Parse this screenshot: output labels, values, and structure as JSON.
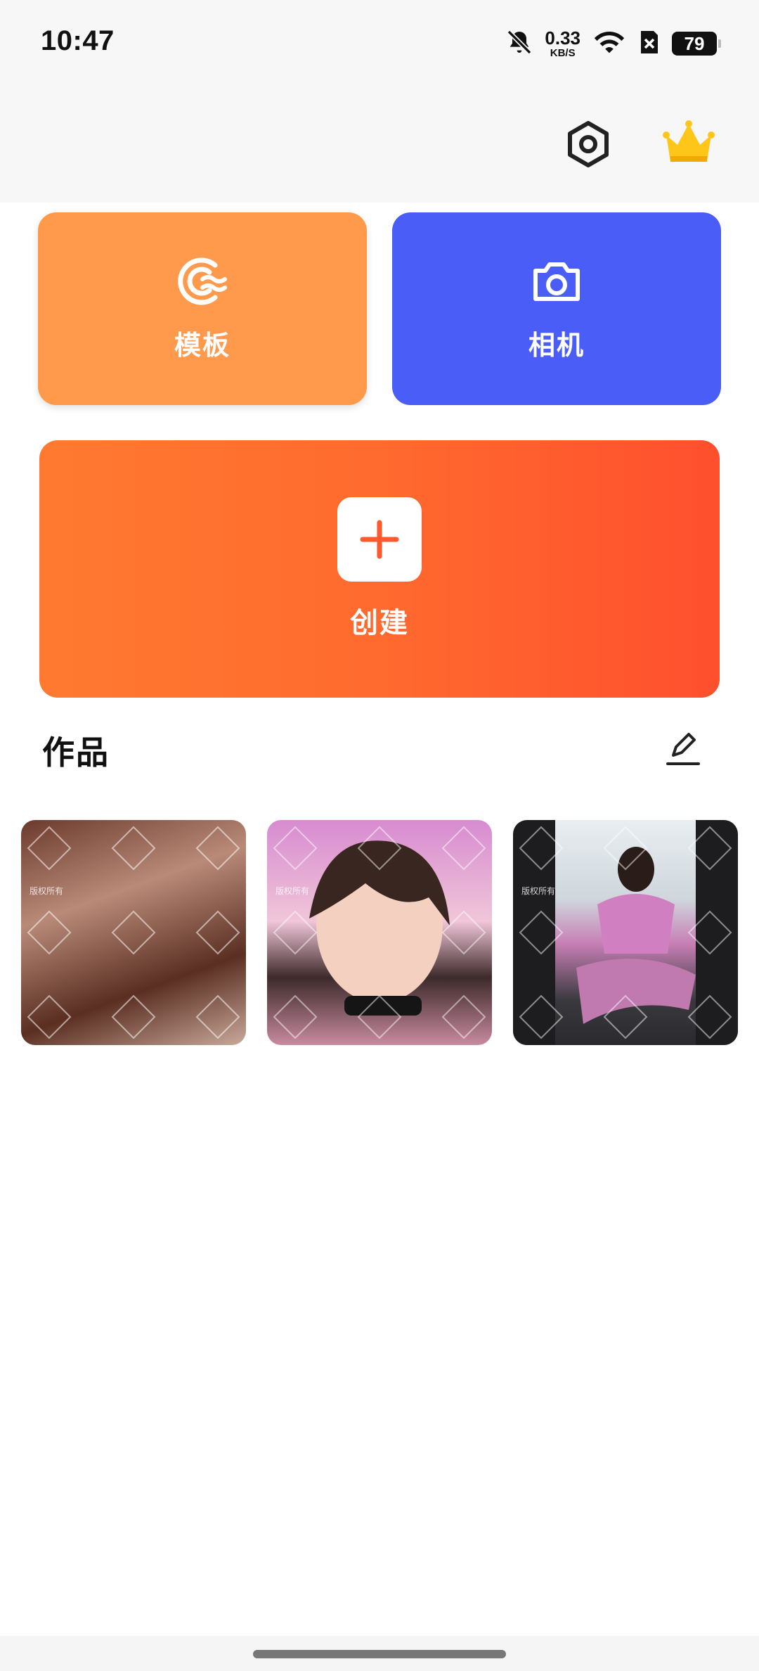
{
  "status_bar": {
    "time": "10:47",
    "net_speed_value": "0.33",
    "net_speed_unit": "KB/S",
    "battery": "79",
    "icons": [
      "bell-off-icon",
      "wifi-icon",
      "sim-off-icon",
      "battery-icon"
    ]
  },
  "header": {
    "icons": [
      "settings-hexagon-icon",
      "crown-icon"
    ],
    "crown_color": "#ffc61a"
  },
  "actions": {
    "template": {
      "label": "模板",
      "icon": "wave-logo-icon",
      "color": "#ff9a4c"
    },
    "camera": {
      "label": "相机",
      "icon": "camera-icon",
      "color": "#4a5ef7"
    },
    "create": {
      "label": "创建",
      "icon": "plus-icon",
      "color": "#ff6a2e"
    }
  },
  "works": {
    "title": "作品",
    "edit_icon": "edit-pencil-icon",
    "items": [
      {
        "name": "work-thumbnail-1",
        "watermark": "版权所有"
      },
      {
        "name": "work-thumbnail-2",
        "watermark": "版权所有"
      },
      {
        "name": "work-thumbnail-3",
        "watermark": "版权所有"
      }
    ]
  }
}
